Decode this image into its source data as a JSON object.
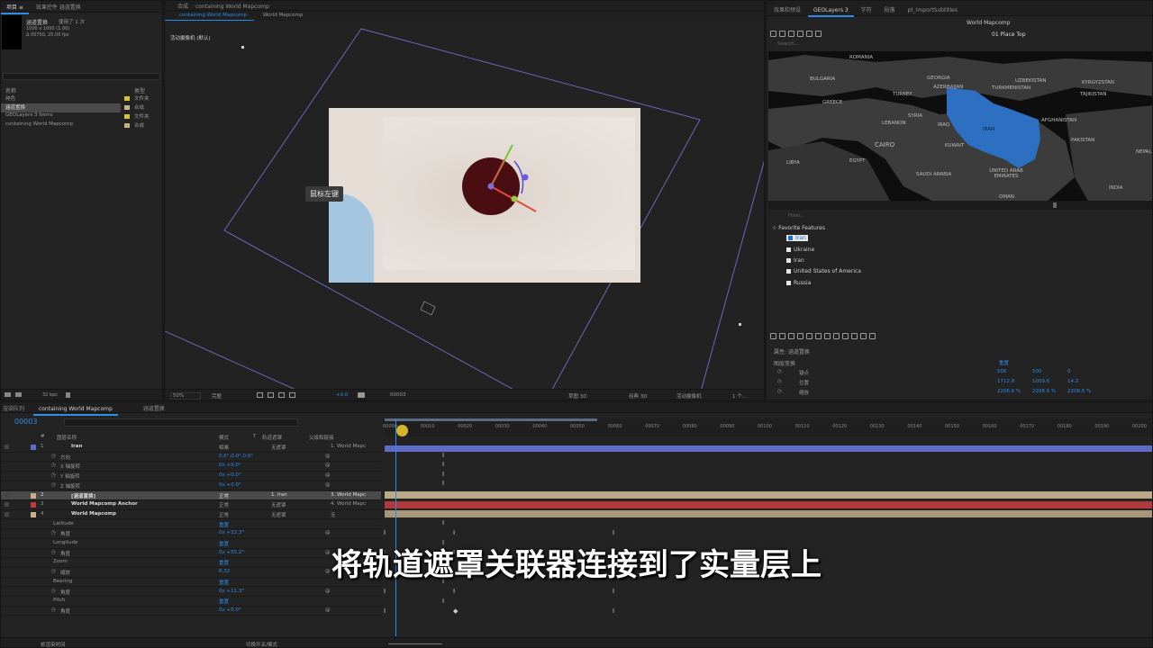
{
  "project": {
    "tab": "项目 ≡",
    "tab_extra": "效果控件 涵道置换",
    "item_name": "涵道置换",
    "used": "使用了 1 次",
    "dims": "1000 x 1000 (1.00)",
    "duration": "Δ 00750, 25.00 fps",
    "col_name": "名称",
    "col_type": "类型",
    "items": [
      {
        "name": "纯色",
        "type": "文件夹",
        "color": "#d9c23a"
      },
      {
        "name": "涵道置换",
        "type": "合成",
        "color": "#c6b188",
        "selected": true
      },
      {
        "name": "GEOLayers 3 Items",
        "type": "文件夹",
        "color": "#d9c23a"
      },
      {
        "name": "containing World Mapcomp",
        "type": "合成",
        "color": "#c6b188"
      }
    ],
    "bpc": "32 bpc"
  },
  "comp": {
    "title": "合成",
    "title_active": "containing World Mapcomp",
    "tabs": [
      "containing World Mapcomp",
      "World Mapcomp"
    ],
    "camera": "活动摄像机 (默认)",
    "tooltip": "鼠标左键",
    "zoom": "50%",
    "quality": "完整",
    "exposure": "+0.0",
    "timecode": "00003",
    "renderer": "草图 3D",
    "view": "经典 3D",
    "active_camera": "活动摄像机",
    "views": "1 个..."
  },
  "right_tabs": [
    "效果和预设",
    "GEOLayers 3",
    "字符",
    "段落",
    "pt_ImportSubtitles"
  ],
  "geo": {
    "comp_name": "World Mapcomp",
    "preset": "01 Place Top",
    "search_placeholder": "Search...",
    "filter_placeholder": "Filter...",
    "countries": [
      "ROMANIA",
      "BULGARIA",
      "GEORGIA",
      "AZERBAIJAN",
      "TURKEY",
      "UZBEKISTAN",
      "KYRGYZSTAN",
      "TURKMENISTAN",
      "TAJIKISTAN",
      "GREECE",
      "SYRIA",
      "LEBANON",
      "IRAQ",
      "IRAN",
      "AFGHANISTAN",
      "CAIRO",
      "KUWAIT",
      "PAKISTAN",
      "NEPAL",
      "LIBYA",
      "EGYPT",
      "SAUDI ARABIA",
      "UNITED ARAB EMIRATES",
      "INDIA",
      "OMAN"
    ],
    "favorites_title": "Favorite Features",
    "favorites": [
      "Iran",
      "Ukraine",
      "Iran",
      "United States of America",
      "Russia"
    ]
  },
  "props": {
    "title": "属性: 涵道置换",
    "section": "图层变换",
    "reset": "重置",
    "rows": [
      {
        "label": "锚点",
        "v": [
          "500",
          "500",
          "0"
        ]
      },
      {
        "label": "位置",
        "v": [
          "1712.8",
          "1059.6",
          "14.2"
        ]
      },
      {
        "label": "缩放",
        "v": [
          "2206.6 %",
          "2206.6 %",
          "2206.6 %"
        ]
      }
    ]
  },
  "timeline": {
    "tabs": [
      "渲染队列",
      "containing World Mapcomp",
      "涵道置换"
    ],
    "timecode": "00003",
    "fps": "00003 (25.00 fps)",
    "columns": [
      "#",
      "图层名称",
      "模式",
      "T",
      "轨道遮罩",
      "父级和链接"
    ],
    "layers": [
      {
        "num": "1",
        "name": "Iran",
        "mode": "相乘",
        "matte": "无遮罩",
        "parent": "1. World Mapc",
        "color": "#5f6cc7",
        "star": true
      },
      {
        "prop": "方向",
        "val": "0.0°,0.0°,0.0°"
      },
      {
        "prop": "X 轴旋转",
        "val": "0x +0.0°"
      },
      {
        "prop": "Y 轴旋转",
        "val": "0x +0.0°"
      },
      {
        "prop": "Z 轴旋转",
        "val": "0x +0.0°"
      },
      {
        "num": "2",
        "name": "[涵道置换]",
        "mode": "正常",
        "matte": "1. Iran",
        "parent": "3. World Mapc",
        "color": "#c6b188",
        "selected": true
      },
      {
        "num": "3",
        "name": "World Mapcomp Anchor",
        "mode": "正常",
        "matte": "无遮罩",
        "parent": "4. World Mapc",
        "color": "#c0393b"
      },
      {
        "num": "4",
        "name": "World Mapcomp",
        "mode": "正常",
        "matte": "无遮罩",
        "parent": "无",
        "color": "#c6b188"
      },
      {
        "group": "Latitude",
        "reset": "重置"
      },
      {
        "prop": "角度",
        "val": "0x +32.3°"
      },
      {
        "group": "Longitude",
        "reset": "重置"
      },
      {
        "prop": "角度",
        "val": "0x +55.2°"
      },
      {
        "group": "Zoom",
        "reset": "重置"
      },
      {
        "prop": "缩放",
        "val": "6.32"
      },
      {
        "group": "Bearing",
        "reset": "重置"
      },
      {
        "prop": "角度",
        "val": "0x +11.3°"
      },
      {
        "group": "Pitch",
        "reset": "重置"
      },
      {
        "prop": "角度",
        "val": "0x +0.0°"
      }
    ],
    "ruler": [
      "00000",
      "00010",
      "00020",
      "00030",
      "00040",
      "00050",
      "00060",
      "00070",
      "00080",
      "00090",
      "00100",
      "00110",
      "00120",
      "00130",
      "00140",
      "00150",
      "00160",
      "00170",
      "00180",
      "00190",
      "00200"
    ],
    "footer_left": "帧渲染时间",
    "footer_mid": "切换开关/模式"
  },
  "subtitle": "将轨道遮罩关联器连接到了实量层上",
  "colors": {
    "accent": "#2d8ceb",
    "iran": "#2d6fc0",
    "disk": "#4a0e12"
  }
}
